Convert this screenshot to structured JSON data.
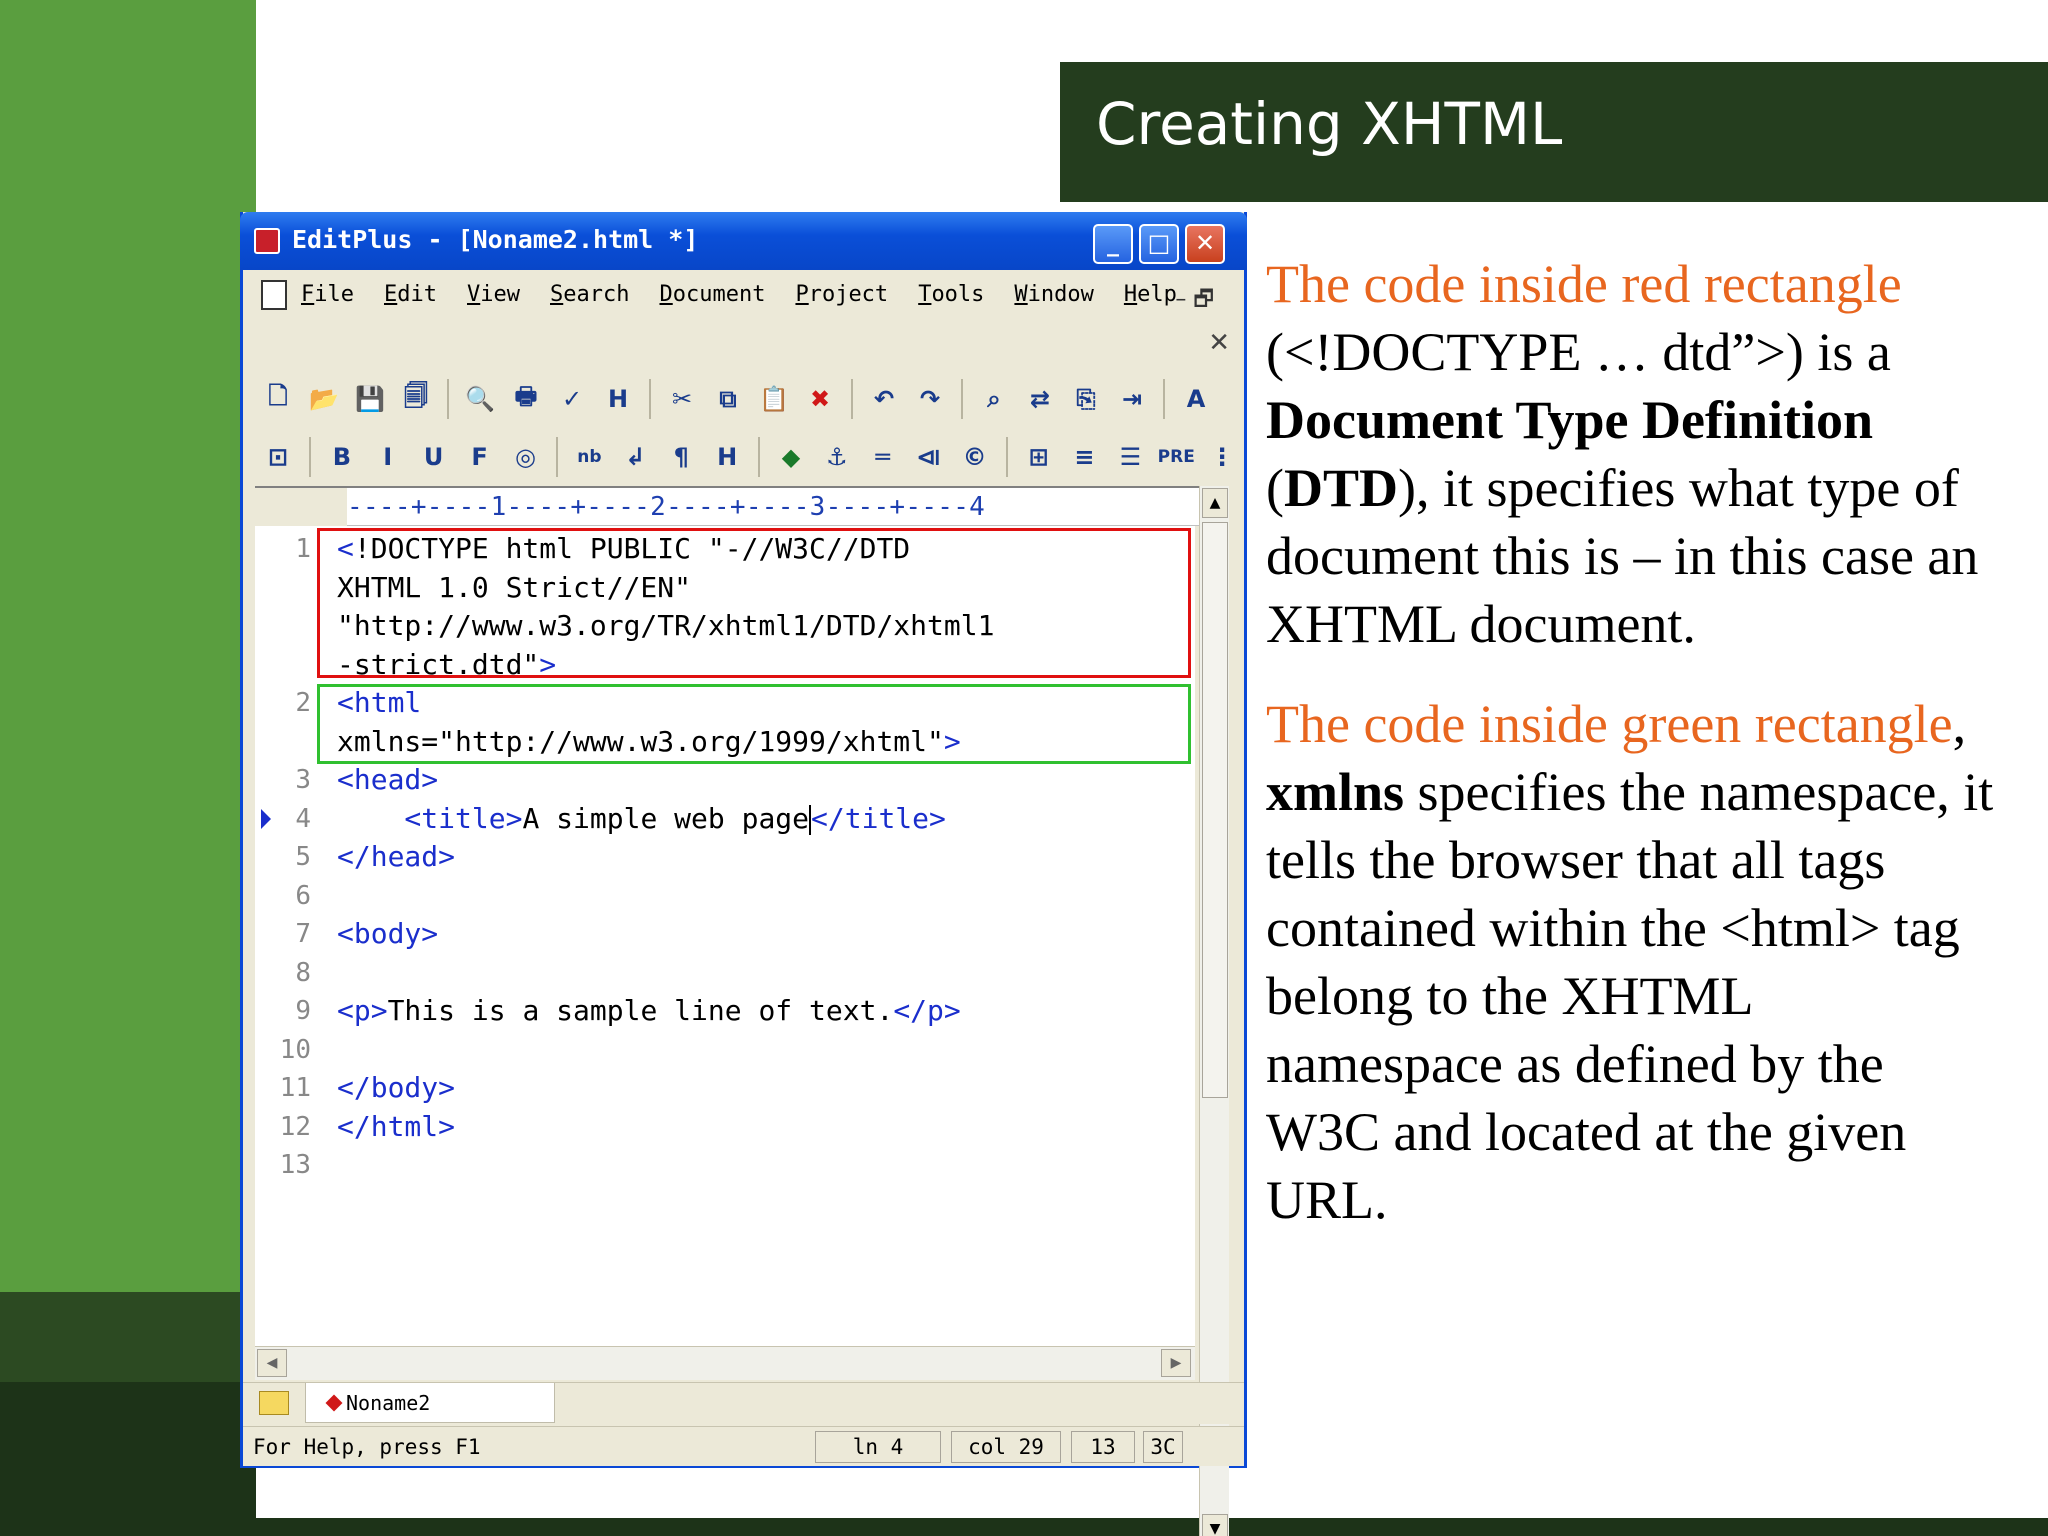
{
  "slide": {
    "title": "Creating XHTML"
  },
  "explanation": {
    "p1": {
      "hl": "The code inside red rectangle",
      "t1": " (<!DOCTYPE … dtd”>) is a ",
      "b1": "Document Type Definition",
      "t2": " (",
      "b2": "DTD",
      "t3": "), it specifies what type of document this is – in this case an XHTML document."
    },
    "p2": {
      "hl": "The code inside green rectangle",
      "t1": ", ",
      "b1": "xmlns",
      "t2": " specifies the namespace, it tells the browser that all tags contained within the <html> tag belong to the XHTML namespace as defined by the W3C and located at the given URL."
    }
  },
  "window": {
    "title": "EditPlus - [Noname2.html *]",
    "controls": {
      "minimize": "_",
      "maximize": "□",
      "close": "✕"
    },
    "menu": [
      "File",
      "Edit",
      "View",
      "Search",
      "Document",
      "Project",
      "Tools",
      "Window",
      "Help"
    ],
    "mdi_controls": "– 🗗",
    "mdi_close": "✕",
    "toolbar1": [
      {
        "name": "new-file-icon",
        "glyph": "🗋"
      },
      {
        "name": "open-folder-icon",
        "glyph": "📂"
      },
      {
        "name": "save-icon",
        "glyph": "💾"
      },
      {
        "name": "save-all-icon",
        "glyph": "🗐"
      },
      {
        "sep": true
      },
      {
        "name": "print-preview-icon",
        "glyph": "🔍"
      },
      {
        "name": "print-icon",
        "glyph": "🖶"
      },
      {
        "name": "spellcheck-icon",
        "glyph": "✓"
      },
      {
        "name": "html-preview-icon",
        "glyph": "H"
      },
      {
        "sep": true
      },
      {
        "name": "cut-icon",
        "glyph": "✂"
      },
      {
        "name": "copy-icon",
        "glyph": "⧉"
      },
      {
        "name": "paste-icon",
        "glyph": "📋"
      },
      {
        "name": "delete-icon",
        "glyph": "✖",
        "cls": "red"
      },
      {
        "sep": true
      },
      {
        "name": "undo-icon",
        "glyph": "↶"
      },
      {
        "name": "redo-icon",
        "glyph": "↷"
      },
      {
        "sep": true
      },
      {
        "name": "find-icon",
        "glyph": "⌕"
      },
      {
        "name": "replace-icon",
        "glyph": "⇄"
      },
      {
        "name": "copy-document-icon",
        "glyph": "⎘"
      },
      {
        "name": "indent-icon",
        "glyph": "⇥"
      },
      {
        "sep": true
      },
      {
        "name": "font-icon",
        "glyph": "A"
      }
    ],
    "toolbar2": [
      {
        "name": "browser-icon",
        "glyph": "⊡"
      },
      {
        "sep": true
      },
      {
        "name": "bold-icon",
        "glyph": "B"
      },
      {
        "name": "italic-icon",
        "glyph": "I"
      },
      {
        "name": "underline-icon",
        "glyph": "U"
      },
      {
        "name": "font-tag-icon",
        "glyph": "F"
      },
      {
        "name": "color-icon",
        "glyph": "◎"
      },
      {
        "sep": true
      },
      {
        "name": "nbsp-icon",
        "glyph": "nb",
        "cls": "small"
      },
      {
        "name": "line-break-icon",
        "glyph": "↲"
      },
      {
        "name": "paragraph-icon",
        "glyph": "¶"
      },
      {
        "name": "heading-icon",
        "glyph": "H"
      },
      {
        "sep": true
      },
      {
        "name": "image-icon",
        "glyph": "◆",
        "cls": "green"
      },
      {
        "name": "anchor-icon",
        "glyph": "⚓"
      },
      {
        "name": "horizontal-rule-icon",
        "glyph": "═"
      },
      {
        "name": "comment-icon",
        "glyph": "⧏"
      },
      {
        "name": "special-char-icon",
        "glyph": "©"
      },
      {
        "sep": true
      },
      {
        "name": "table-icon",
        "glyph": "⊞"
      },
      {
        "name": "center-icon",
        "glyph": "≡"
      },
      {
        "name": "align-icon",
        "glyph": "☰"
      },
      {
        "name": "pre-icon",
        "glyph": "PRE",
        "cls": "small"
      },
      {
        "name": "list-icon",
        "glyph": "⋮"
      }
    ],
    "ruler": "----+----1----+----2----+----3----+----4",
    "code": [
      {
        "n": "1",
        "segs": [
          {
            "c": "tag",
            "t": "<"
          },
          {
            "c": "txt",
            "t": "!DOCTYPE html PUBLIC \"-//W3C//DTD"
          }
        ]
      },
      {
        "n": "",
        "segs": [
          {
            "c": "txt",
            "t": "XHTML 1.0 Strict//EN\""
          }
        ]
      },
      {
        "n": "",
        "segs": [
          {
            "c": "txt",
            "t": "\"http://www.w3.org/TR/xhtml1/DTD/xhtml1"
          }
        ]
      },
      {
        "n": "",
        "segs": [
          {
            "c": "txt",
            "t": "-strict.dtd\""
          },
          {
            "c": "tag",
            "t": ">"
          }
        ]
      },
      {
        "n": "2",
        "segs": [
          {
            "c": "tag",
            "t": "<html"
          }
        ]
      },
      {
        "n": "",
        "segs": [
          {
            "c": "txt",
            "t": "xmlns=\"http://www.w3.org/1999/xhtml\""
          },
          {
            "c": "tag",
            "t": ">"
          }
        ]
      },
      {
        "n": "3",
        "segs": [
          {
            "c": "tag",
            "t": "<head>"
          }
        ]
      },
      {
        "n": "4",
        "marker": true,
        "segs": [
          {
            "c": "tag",
            "t": "    <title>"
          },
          {
            "c": "txt",
            "t": "A simple web page"
          },
          {
            "c": "cursor",
            "t": ""
          },
          {
            "c": "tag",
            "t": "</title>"
          }
        ]
      },
      {
        "n": "5",
        "segs": [
          {
            "c": "tag",
            "t": "</head>"
          }
        ]
      },
      {
        "n": "6",
        "segs": []
      },
      {
        "n": "7",
        "segs": [
          {
            "c": "tag",
            "t": "<body>"
          }
        ]
      },
      {
        "n": "8",
        "segs": []
      },
      {
        "n": "9",
        "segs": [
          {
            "c": "tag",
            "t": "<p>"
          },
          {
            "c": "txt",
            "t": "This is a sample line of text."
          },
          {
            "c": "tag",
            "t": "</p>"
          }
        ]
      },
      {
        "n": "10",
        "segs": []
      },
      {
        "n": "11",
        "segs": [
          {
            "c": "tag",
            "t": "</body>"
          }
        ]
      },
      {
        "n": "12",
        "segs": [
          {
            "c": "tag",
            "t": "</html>"
          }
        ]
      },
      {
        "n": "13",
        "segs": []
      }
    ],
    "file_tab": "Noname2",
    "status": {
      "help": "For Help, press F1",
      "line": "ln 4",
      "col": "col 29",
      "lines": "13",
      "code": "3C"
    }
  }
}
